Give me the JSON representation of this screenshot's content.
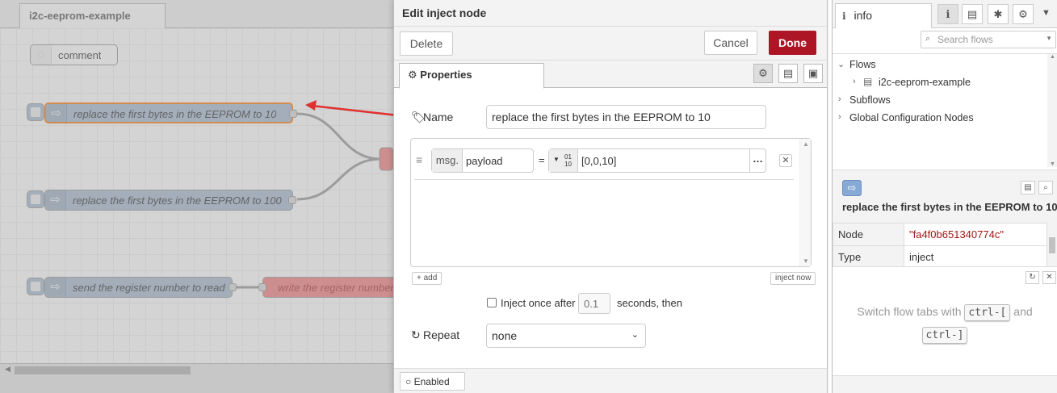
{
  "workspace": {
    "tab_title": "i2c-eeprom-example",
    "comment_label": "comment",
    "nodes": [
      "replace the first bytes in the EEPROM to 10",
      "replace the first bytes in the EEPROM to 100",
      "send the register number to read",
      "write the register number"
    ]
  },
  "tray": {
    "title": "Edit inject node",
    "delete_label": "Delete",
    "cancel_label": "Cancel",
    "done_label": "Done",
    "properties_tab": "Properties",
    "name_label": "Name",
    "name_value": "replace the first bytes in the EEPROM to 10",
    "msg_prefix": "msg.",
    "msg_prop": "payload",
    "equals": "=",
    "type_glyph_top": "01",
    "type_glyph_bottom": "10",
    "payload_value": "[0,0,10]",
    "add_label": "add",
    "inject_now_label": "inject now",
    "inject_once_label": "Inject once after",
    "inject_delay_placeholder": "0.1",
    "seconds_then": "seconds, then",
    "repeat_label": "Repeat",
    "repeat_value": "none",
    "enabled_label": "Enabled"
  },
  "sidebar": {
    "tab_label": "info",
    "search_placeholder": "Search flows",
    "tree": {
      "flows": "Flows",
      "flow_item": "i2c-eeprom-example",
      "subflows": "Subflows",
      "global_config": "Global Configuration Nodes"
    },
    "selected_node_title": "replace the first bytes in the EEPROM to 10",
    "props": {
      "node_key": "Node",
      "node_value": "\"fa4f0b651340774c\"",
      "type_key": "Type",
      "type_value": "inject"
    },
    "help": {
      "text_1": "Switch flow tabs with",
      "key_1": "ctrl-[",
      "and": "and",
      "key_2": "ctrl-]"
    }
  },
  "colors": {
    "accent_red": "#ad1625",
    "inject_node": "#a6bbcf",
    "function_node": "#e2d96e",
    "i2c_node": "#f08080",
    "arrow": "#e03030"
  }
}
